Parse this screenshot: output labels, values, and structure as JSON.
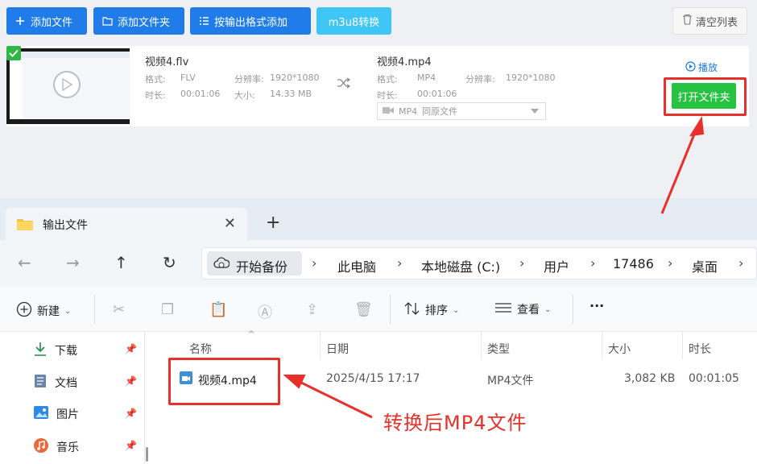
{
  "converter": {
    "toolbar": {
      "add_file": "添加文件",
      "add_folder": "添加文件夹",
      "add_by_format": "按输出格式添加",
      "m3u8": "m3u8转换",
      "clear_list": "清空列表"
    },
    "source": {
      "name": "视频4.flv",
      "format_label": "格式:",
      "format": "FLV",
      "resolution_label": "分辨率:",
      "resolution": "1920*1080",
      "duration_label": "时长:",
      "duration": "00:01:06",
      "size_label": "大小:",
      "size": "14.33 MB"
    },
    "output": {
      "name": "视频4.mp4",
      "format_label": "格式:",
      "format": "MP4",
      "resolution_label": "分辨率:",
      "resolution": "1920*1080",
      "duration_label": "时长:",
      "duration": "00:01:06",
      "select_format": "MP4",
      "select_quality": "同原文件"
    },
    "play": "播放",
    "open_folder": "打开文件夹"
  },
  "explorer": {
    "tab_title": "输出文件",
    "breadcrumb": [
      "开始备份",
      "此电脑",
      "本地磁盘 (C:)",
      "用户",
      "17486",
      "桌面"
    ],
    "commands": {
      "new": "新建",
      "sort": "排序",
      "view": "查看",
      "more": "···"
    },
    "sidebar": [
      {
        "label": "下载"
      },
      {
        "label": "文档"
      },
      {
        "label": "图片"
      },
      {
        "label": "音乐"
      }
    ],
    "columns": [
      "名称",
      "日期",
      "类型",
      "大小",
      "时长"
    ],
    "rows": [
      {
        "name": "视频4.mp4",
        "date": "2025/4/15 17:17",
        "type": "MP4文件",
        "size": "3,082 KB",
        "duration": "00:01:05"
      }
    ]
  },
  "annotation": "转换后MP4文件",
  "colors": {
    "primary_blue": "#1f7ce8",
    "m3u8_cyan": "#3fc6f6",
    "open_green": "#28c243",
    "annotation_red": "#e8302a"
  }
}
